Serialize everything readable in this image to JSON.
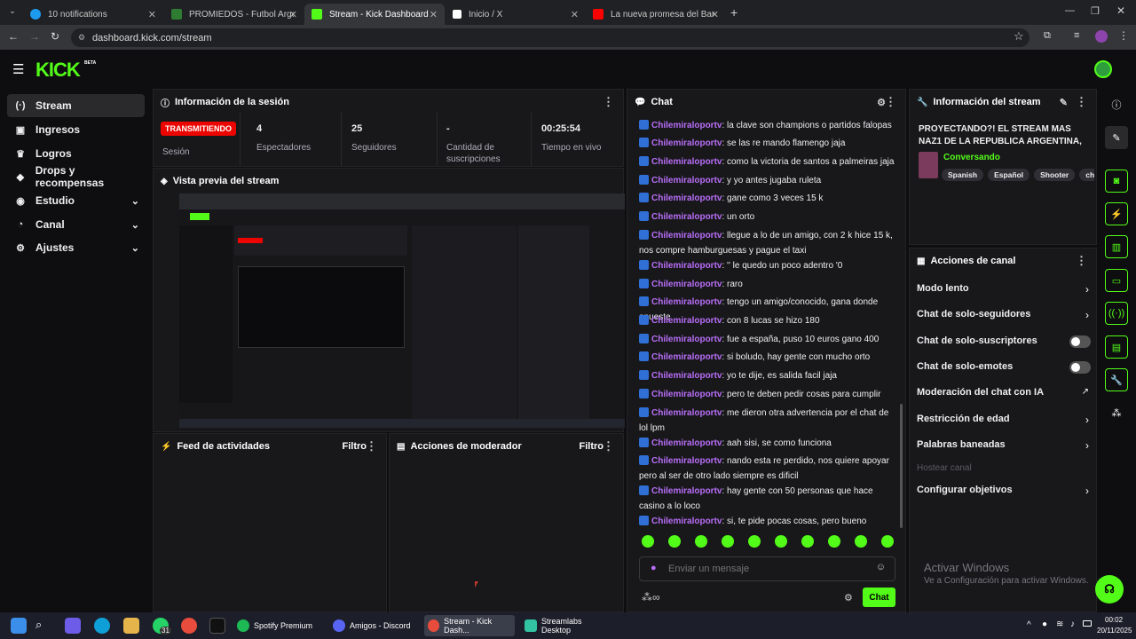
{
  "browser": {
    "tabs": [
      {
        "label": "10 notifications",
        "color": "#1d9bf0"
      },
      {
        "label": "PROMIEDOS - Futbol Argentino",
        "color": "#2e7d32"
      },
      {
        "label": "Stream - Kick Dashboard",
        "color": "#53fc18"
      },
      {
        "label": "Inicio / X",
        "color": "#ffffff"
      },
      {
        "label": "La nueva promesa del Barça no",
        "color": "#ff0000"
      }
    ],
    "url": "dashboard.kick.com/stream"
  },
  "header": {
    "logo": "KICK",
    "beta": "BETA"
  },
  "sidebar": {
    "items": [
      {
        "label": "Stream",
        "icon": "broadcast-icon"
      },
      {
        "label": "Ingresos",
        "icon": "wallet-icon"
      },
      {
        "label": "Logros",
        "icon": "trophy-icon"
      },
      {
        "label": "Drops y recompensas",
        "icon": "gift-icon"
      },
      {
        "label": "Estudio",
        "icon": "studio-icon"
      },
      {
        "label": "Canal",
        "icon": "channel-icon"
      },
      {
        "label": "Ajustes",
        "icon": "gear-icon"
      }
    ]
  },
  "session": {
    "title": "Información de la sesión",
    "badge": "TRANSMITIENDO",
    "badge_label": "Sesión",
    "stats": [
      {
        "value": "4",
        "label": "Espectadores"
      },
      {
        "value": "25",
        "label": "Seguidores"
      },
      {
        "value": "-",
        "label": "Cantidad de suscripciones"
      },
      {
        "value": "00:25:54",
        "label": "Tiempo en vivo"
      }
    ]
  },
  "preview": {
    "title": "Vista previa del stream"
  },
  "activity": {
    "title": "Feed de actividades",
    "filter": "Filtro"
  },
  "moderator": {
    "title": "Acciones de moderador",
    "filter": "Filtro"
  },
  "chat": {
    "title": "Chat",
    "messages": [
      {
        "user": "Chilemiraloportv",
        "text": "la clave son champions o partidos falopas"
      },
      {
        "user": "Chilemiraloportv",
        "text": "se las re mando flamengo jaja"
      },
      {
        "user": "Chilemiraloportv",
        "text": "como la victoria de santos a palmeiras jaja"
      },
      {
        "user": "Chilemiraloportv",
        "text": "y yo antes jugaba ruleta"
      },
      {
        "user": "Chilemiraloportv",
        "text": "gane como 3 veces 15 k"
      },
      {
        "user": "Chilemiraloportv",
        "text": "un orto"
      },
      {
        "user": "Chilemiraloportv",
        "text": "llegue a lo de un amigo, con 2 k hice 15 k, nos compre hamburguesas y pague el taxi"
      },
      {
        "user": "Chilemiraloportv",
        "text": "'' le quedo un poco adentro '0"
      },
      {
        "user": "Chilemiraloportv",
        "text": "raro"
      },
      {
        "user": "Chilemiraloportv",
        "text": "tengo un amigo/conocido, gana donde apueste"
      },
      {
        "user": "Chilemiraloportv",
        "text": "con 8 lucas se hizo 180"
      },
      {
        "user": "Chilemiraloportv",
        "text": "fue a españa, puso 10 euros gano 400"
      },
      {
        "user": "Chilemiraloportv",
        "text": "si boludo, hay gente con mucho orto"
      },
      {
        "user": "Chilemiraloportv",
        "text": "yo te dije, es salida facil jaja"
      },
      {
        "user": "Chilemiraloportv",
        "text": "pero te deben pedir cosas para cumplir"
      },
      {
        "user": "Chilemiraloportv",
        "text": "me dieron otra advertencia por el chat de lol lpm"
      },
      {
        "user": "Chilemiraloportv",
        "text": "aah sisi, se como funciona"
      },
      {
        "user": "Chilemiraloportv",
        "text": "nando esta re perdido, nos quiere apoyar pero al ser de otro lado siempre es dificil"
      },
      {
        "user": "Chilemiraloportv",
        "text": "hay gente con 50 personas que hace casino a lo loco"
      },
      {
        "user": "Chilemiraloportv",
        "text": "si, te pide pocas cosas, pero bueno"
      }
    ],
    "input_placeholder": "Enviar un mensaje",
    "send_label": "Chat"
  },
  "stream_info": {
    "title": "Información del stream",
    "stream_title": "PROYECTANDO?! EL STREAM MAS NAZ1 DE LA REPUBLICA ARGENTINA, SI TE...",
    "category": "Conversando",
    "tags": [
      "Spanish",
      "Español",
      "Shooter",
      "chill"
    ]
  },
  "channel_actions": {
    "title": "Acciones de canal",
    "rows": [
      {
        "label": "Modo lento",
        "control": "chevron"
      },
      {
        "label": "Chat de solo-seguidores",
        "control": "chevron"
      },
      {
        "label": "Chat de solo-suscriptores",
        "control": "toggle",
        "on": false
      },
      {
        "label": "Chat de solo-emotes",
        "control": "toggle",
        "on": false
      },
      {
        "label": "Moderación del chat con IA",
        "control": "external"
      },
      {
        "label": "Restricción de edad",
        "control": "chevron"
      },
      {
        "label": "Palabras baneadas",
        "control": "chevron"
      },
      {
        "label": "Hostear canal",
        "control": "disabled"
      },
      {
        "label": "Configurar objetivos",
        "control": "chevron"
      }
    ]
  },
  "watermark": {
    "line1": "Activar Windows",
    "line2": "Ve a Configuración para activar Windows."
  },
  "taskbar": {
    "apps": [
      "Spotify Premium",
      "Amigos - Discord",
      "Stream - Kick Dash...",
      "Streamlabs Desktop"
    ],
    "badge": "31",
    "time": "00:02",
    "date": "20/11/2025"
  },
  "colors": {
    "accent": "#53fc18",
    "live": "#eb0400",
    "username": "#b86ef7"
  }
}
